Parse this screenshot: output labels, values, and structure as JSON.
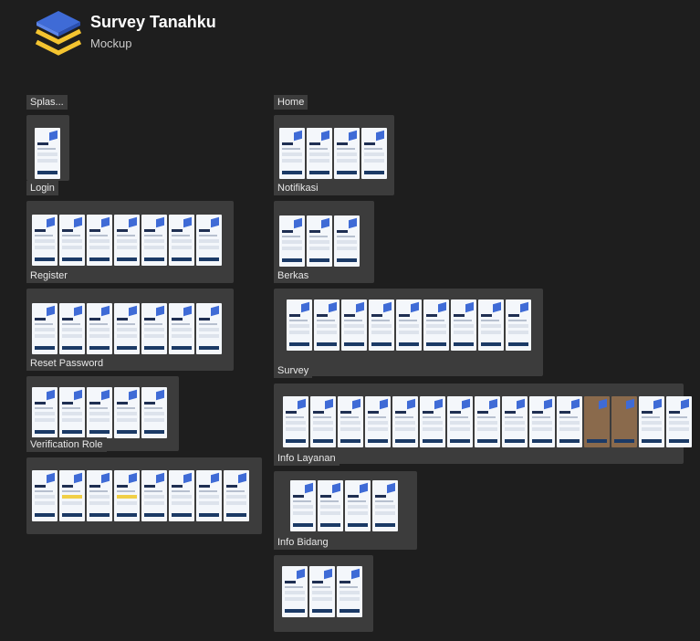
{
  "app": {
    "title": "Survey Tanahku",
    "subtitle": "Mockup",
    "logo_icon": "stacked-layers-logo"
  },
  "sections": [
    {
      "id": "splash",
      "label": "Splas...",
      "screens": 1
    },
    {
      "id": "login",
      "label": "Login",
      "screens": 7
    },
    {
      "id": "register",
      "label": "Register",
      "screens": 7
    },
    {
      "id": "reset-password",
      "label": "Reset Password",
      "screens": 5
    },
    {
      "id": "verification-role",
      "label": "Verification Role",
      "screens": 8
    },
    {
      "id": "home",
      "label": "Home",
      "screens": 4
    },
    {
      "id": "notifikasi",
      "label": "Notifikasi",
      "screens": 3
    },
    {
      "id": "berkas",
      "label": "Berkas",
      "screens": 9
    },
    {
      "id": "survey",
      "label": "Survey",
      "screens": 15
    },
    {
      "id": "info-layanan",
      "label": "Info Layanan",
      "screens": 4
    },
    {
      "id": "info-bidang",
      "label": "Info Bidang",
      "screens": 3
    }
  ],
  "colors": {
    "background": "#1e1e1e",
    "frame": "#3c3c3c",
    "brand_blue": "#3f6bd6",
    "brand_yellow": "#f4c430",
    "navy": "#1b3a66"
  }
}
